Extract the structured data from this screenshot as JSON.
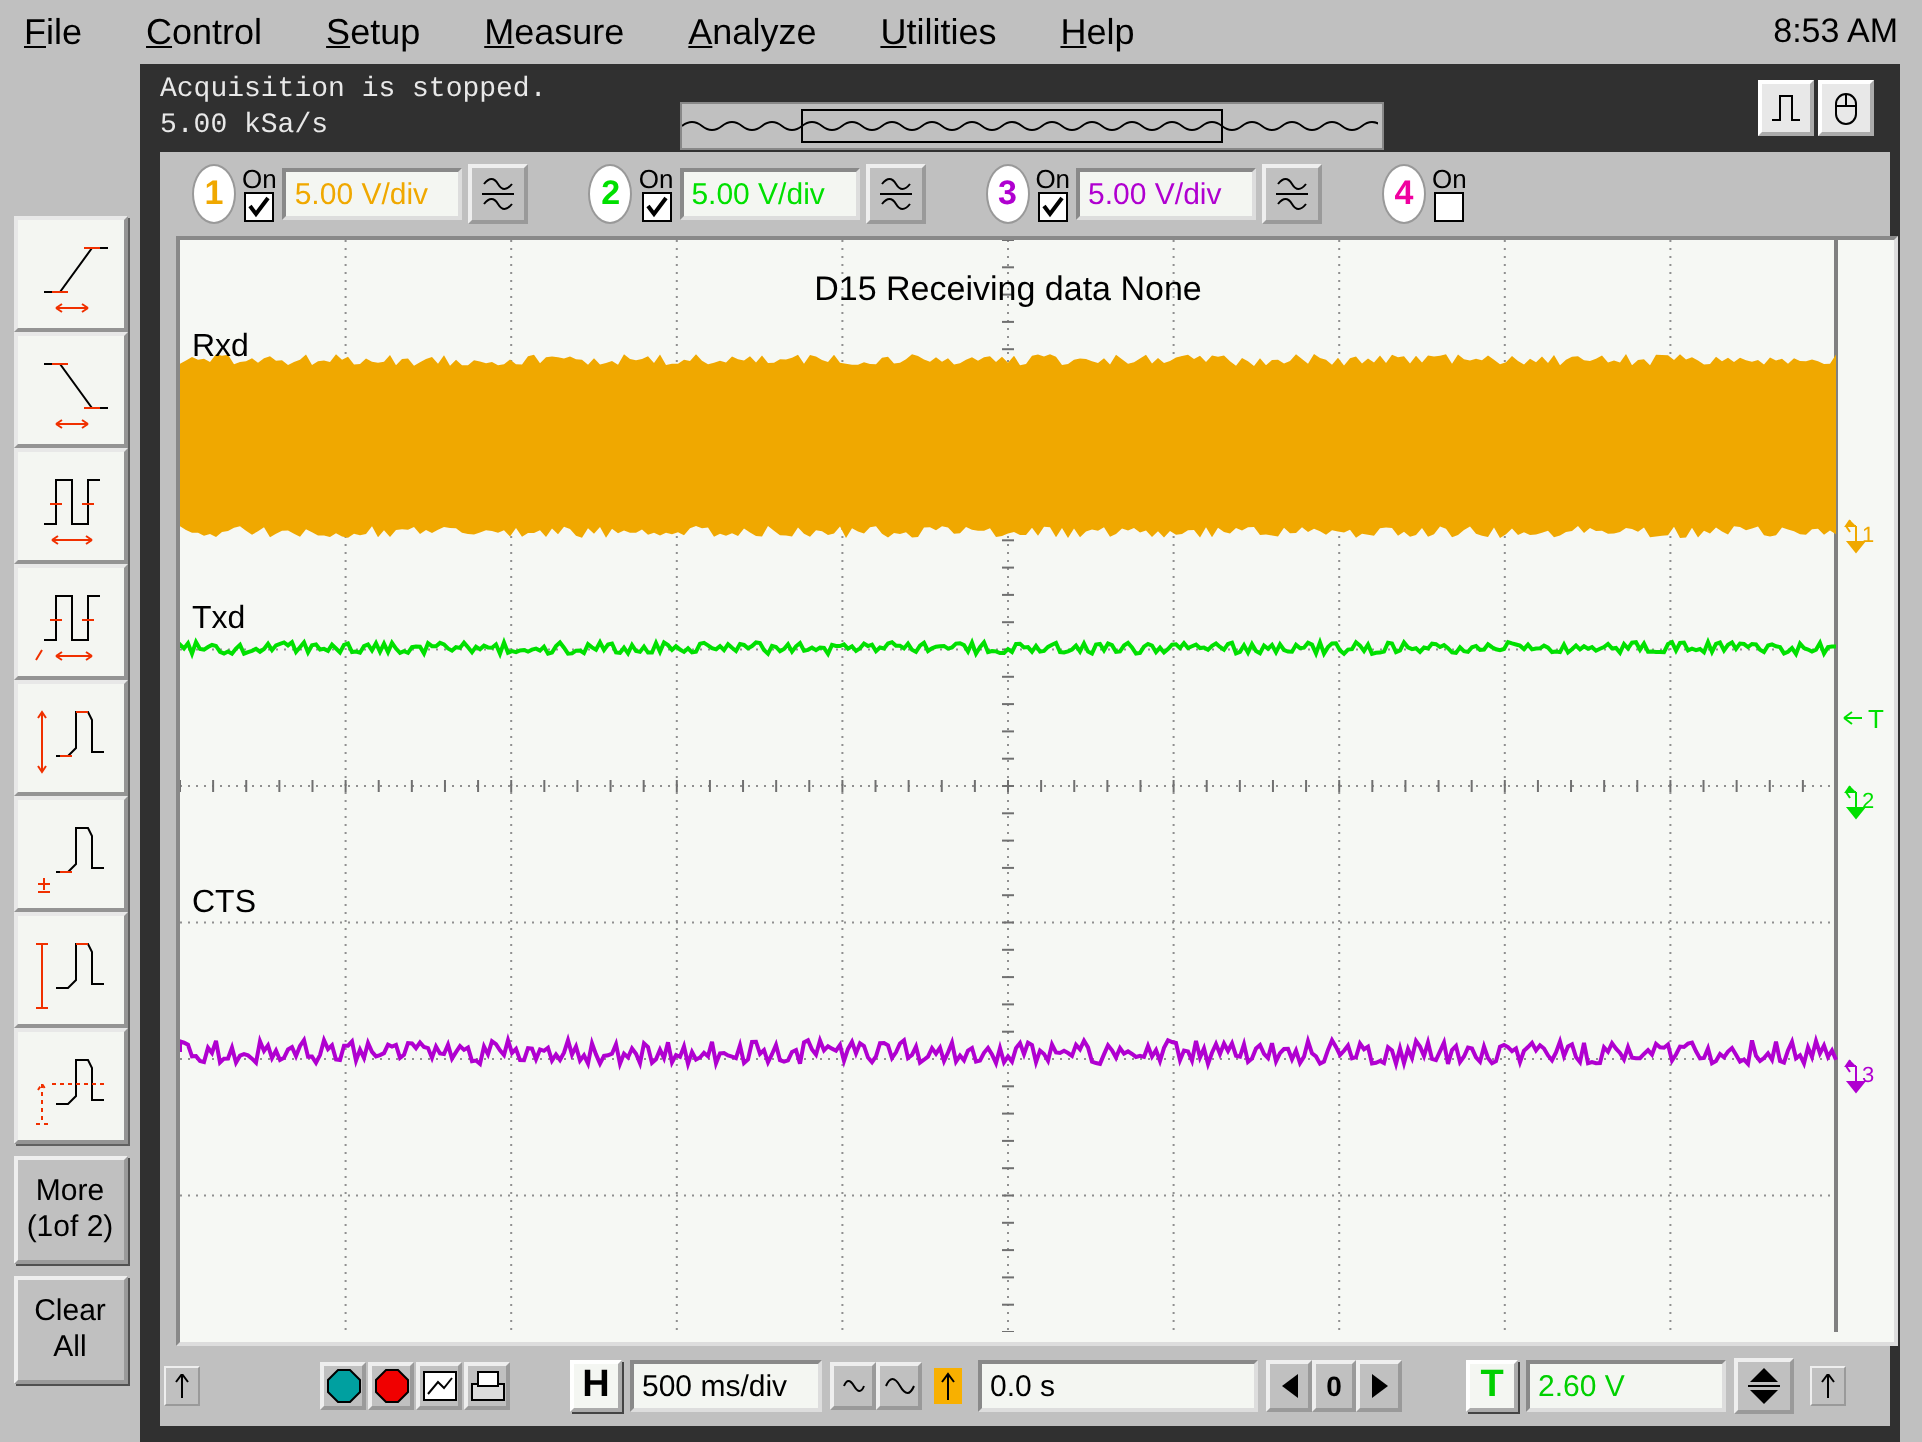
{
  "menu": [
    "File",
    "Control",
    "Setup",
    "Measure",
    "Analyze",
    "Utilities",
    "Help"
  ],
  "clock": "8:53 AM",
  "status": {
    "lines": [
      "Acquisition is stopped.",
      "5.00 kSa/s"
    ]
  },
  "channels": [
    {
      "number": "1",
      "label": "On",
      "on": true,
      "scale": "5.00 V/div",
      "color": "#f0a800"
    },
    {
      "number": "2",
      "label": "On",
      "on": true,
      "scale": "5.00 V/div",
      "color": "#00e000"
    },
    {
      "number": "3",
      "label": "On",
      "on": true,
      "scale": "5.00 V/div",
      "color": "#b000d0"
    },
    {
      "number": "4",
      "label": "On",
      "on": false,
      "color": "#f000a0"
    }
  ],
  "sidebar": {
    "buttons": [
      "More (1of 2)",
      "Clear All"
    ]
  },
  "plot": {
    "title": "D15 Receiving data None",
    "traces": [
      {
        "label": "Rxd",
        "kind": "band"
      },
      {
        "label": "Txd",
        "kind": "line"
      },
      {
        "label": "CTS",
        "kind": "line"
      }
    ],
    "markers": [
      {
        "label": "1",
        "kind": "ground"
      },
      {
        "label": "T",
        "kind": "trigger"
      },
      {
        "label": "2",
        "kind": "ground"
      },
      {
        "label": "3",
        "kind": "ground"
      }
    ]
  },
  "toolbar": {
    "horizontal_key": "H",
    "time_scale": "500 ms/div",
    "delay": "0.0 s",
    "delay_reference": "0",
    "trigger_key": "T",
    "trigger_level": "2.60 V"
  }
}
